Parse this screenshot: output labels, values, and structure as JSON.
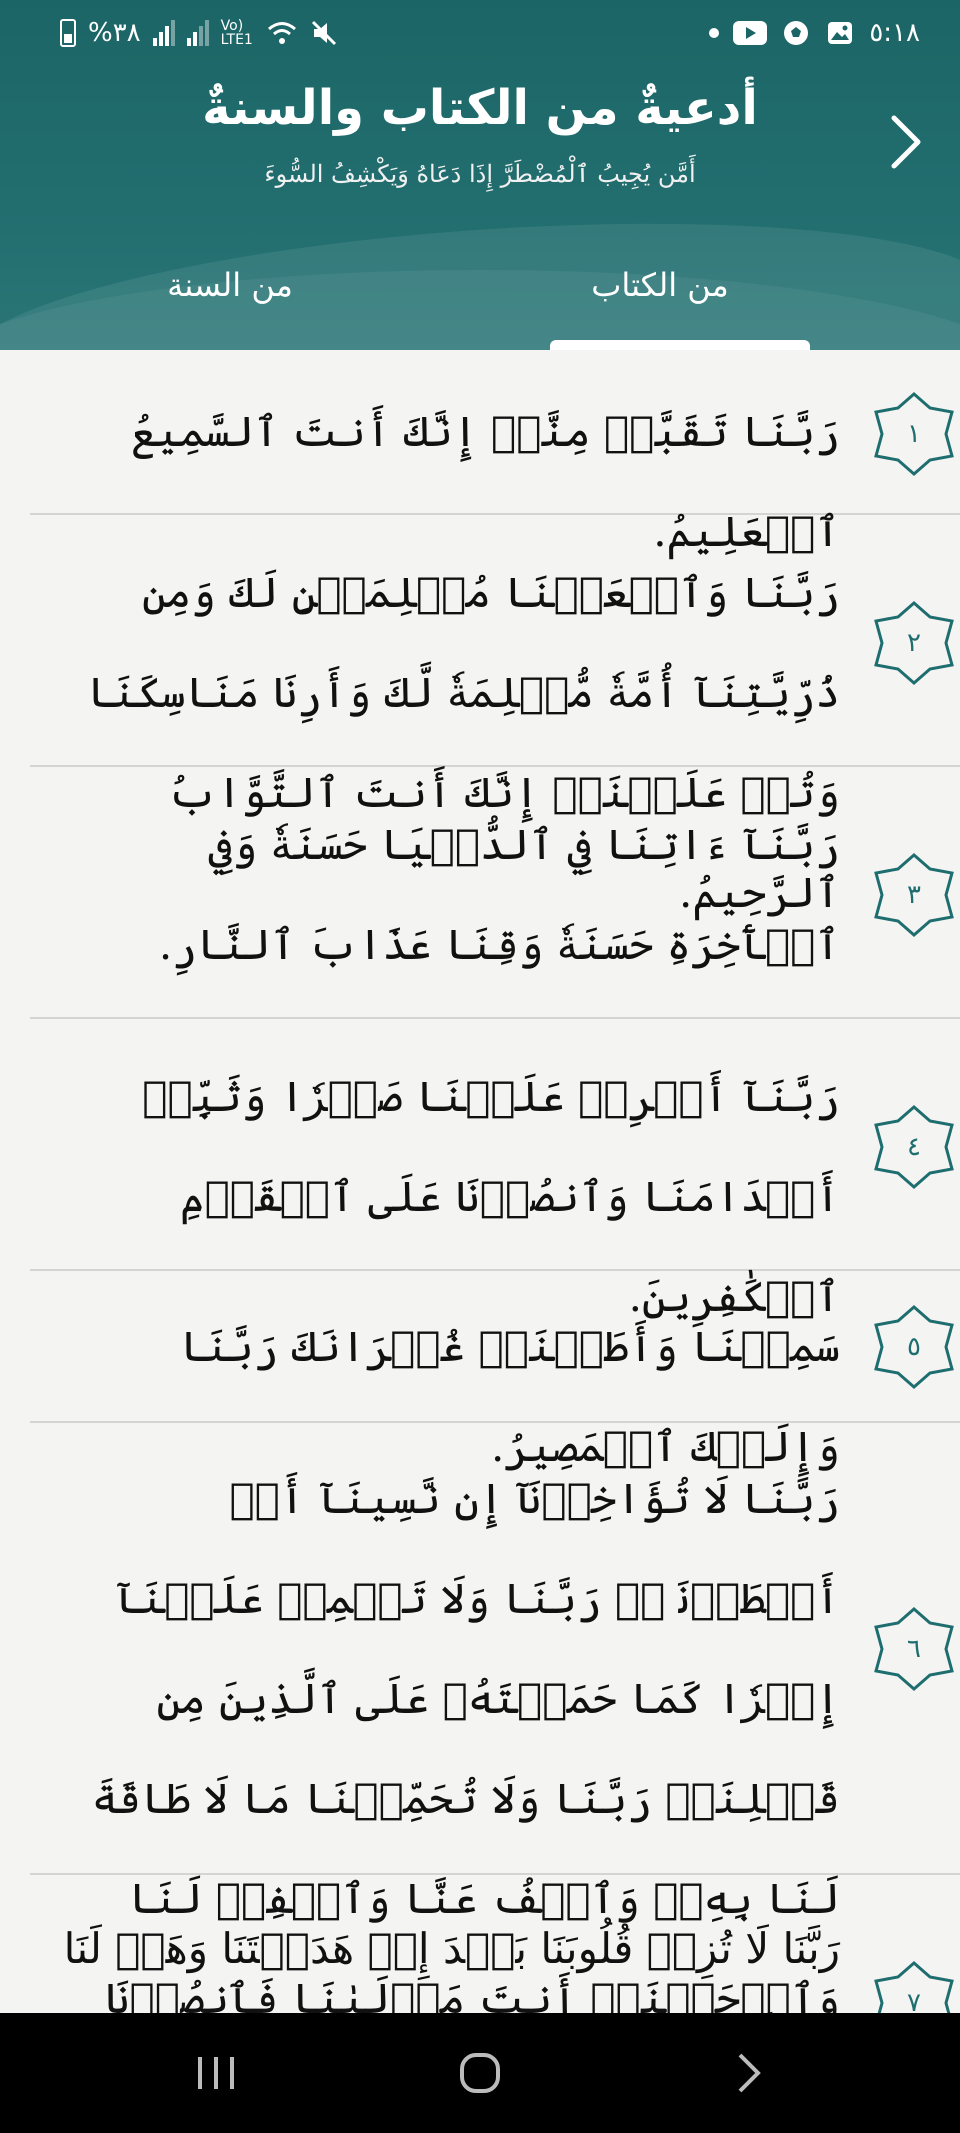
{
  "status_bar": {
    "battery": "%٣٨",
    "network": "Vo) LTE1",
    "time": "٥:١٨"
  },
  "header": {
    "title": "أدعيةٌ من الكتاب والسنةٌ",
    "subtitle": "أَمَّن يُجِيبُ ٱلْمُضْطَرَّ إِذَا دَعَاهُ وَيَكْشِفُ السُّوءَ"
  },
  "tabs": [
    {
      "label": "من الكتاب",
      "active": true
    },
    {
      "label": "من السنة",
      "active": false
    }
  ],
  "duas": [
    {
      "number": "١",
      "text": "رَبَّنَا تَقَبَّلۡ مِنَّآۖ إِنَّكَ أَنتَ ٱلسَّمِيعُ ٱلۡعَلِيمُ."
    },
    {
      "number": "٢",
      "text": "رَبَّنَا وَٱجۡعَلۡنَا مُسۡلِمَيۡنِ لَكَ وَمِن ذُرِّيَّتِنَآ أُمَّةٗ مُّسۡلِمَةٗ لَّكَ وَأَرِنَا مَنَاسِكَنَا وَتُبۡ عَلَيۡنَآۖ إِنَّكَ أَنتَ ٱلتَّوَّابُ ٱلرَّحِيمُ."
    },
    {
      "number": "٣",
      "text": "رَبَّنَآ ءَاتِنَا فِي ٱلدُّنۡيَا حَسَنَةٗ وَفِي ٱلۡأٓخِرَةِ حَسَنَةٗ وَقِنَا عَذَابَ ٱلنَّارِ."
    },
    {
      "number": "٤",
      "text": "رَبَّنَآ أَفۡرِغۡ عَلَيۡنَا صَبۡرٗا وَثَبِّتۡ أَقۡدَامَنَا وَٱنصُرۡنَا عَلَى ٱلۡقَوۡمِ ٱلۡكَٰفِرِينَ."
    },
    {
      "number": "٥",
      "text": "سَمِعۡنَا وَأَطَعۡنَاۖ غُفۡرَانَكَ رَبَّنَا وَإِلَيۡكَ ٱلۡمَصِيرُ."
    },
    {
      "number": "٦",
      "text": "رَبَّنَا لَا تُؤَاخِذۡنَآ إِن نَّسِينَآ أَوۡ أَخۡطَأۡنَاۚ رَبَّنَا وَلَا تَحۡمِلۡ عَلَيۡنَآ إِصۡرٗا كَمَا حَمَلۡتَهُۥ عَلَى ٱلَّذِينَ مِن قَبۡلِنَاۚ رَبَّنَا وَلَا تُحَمِّلۡنَا مَا لَا طَاقَةَ لَنَا بِهِۦۖ وَٱعۡفُ عَنَّا وَٱغۡفِرۡ لَنَا وَٱرۡحَمۡنَآۚ أَنتَ مَوۡلَىٰنَا فَٱنصُرۡنَا عَلَى ٱلۡقَوۡمِ ٱلۡكَٰفِرِينَ."
    },
    {
      "number": "٧",
      "text": "رَبَّنَا لَا تُزِغۡ قُلُوبَنَا بَعۡدَ إِذۡ هَدَيۡتَنَا وَهَبۡ لَنَا مِن لَّدُنكَ"
    }
  ],
  "colors": {
    "header": "#1c6566",
    "accent": "#1f6e6f",
    "background": "#f4f4f2"
  }
}
